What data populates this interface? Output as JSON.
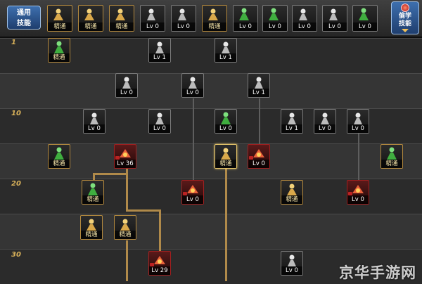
{
  "header": {
    "common_skills_label": "通用\n技能",
    "steal_skill_button": "偷学\n技能",
    "common_skills": [
      {
        "icon": "squat-figure-icon",
        "label": "精通",
        "state": "unlocked"
      },
      {
        "icon": "flail-figure-icon",
        "label": "精通",
        "state": "unlocked"
      },
      {
        "icon": "sprint-figure-icon",
        "label": "精通",
        "state": "unlocked"
      },
      {
        "icon": "eagle-wings-icon",
        "label": "Lv 0",
        "state": "locked"
      },
      {
        "icon": "target-scope-icon",
        "label": "Lv 0",
        "state": "locked"
      },
      {
        "icon": "crosshair-icon",
        "label": "精通",
        "state": "unlocked"
      },
      {
        "icon": "crouch-green-icon",
        "label": "Lv 0",
        "state": "locked"
      },
      {
        "icon": "dash-green-icon",
        "label": "Lv 0",
        "state": "locked"
      },
      {
        "icon": "eye-icon",
        "label": "Lv 0",
        "state": "locked"
      },
      {
        "icon": "strongman-icon",
        "label": "Lv 0",
        "state": "locked"
      },
      {
        "icon": "dual-blade-icon",
        "label": "Lv 0",
        "state": "locked"
      }
    ]
  },
  "level_markers": [
    "1",
    "10",
    "20",
    "30"
  ],
  "skill_tree": [
    {
      "name": "green-book-skill",
      "icon": "book-icon",
      "label": "精通",
      "state": "unlocked"
    },
    {
      "name": "rock-throw-skill",
      "icon": "rock-icon",
      "label": "Lv 1",
      "state": "locked"
    },
    {
      "name": "hammer-strike-skill",
      "icon": "hammer-icon",
      "label": "Lv 1",
      "state": "locked"
    },
    {
      "name": "flex-figure-skill",
      "icon": "flex-icon",
      "label": "Lv 0",
      "state": "locked"
    },
    {
      "name": "bow-figure-skill",
      "icon": "bow-icon",
      "label": "Lv 0",
      "state": "locked"
    },
    {
      "name": "pillar-burst-skill",
      "icon": "pillar-icon",
      "label": "Lv 1",
      "state": "locked"
    },
    {
      "name": "scatter-shot-skill",
      "icon": "scatter-icon",
      "label": "Lv 0",
      "state": "locked"
    },
    {
      "name": "spin-slash-skill",
      "icon": "slash-icon",
      "label": "Lv 0",
      "state": "locked"
    },
    {
      "name": "green-armor-skill",
      "icon": "armor-icon",
      "label": "Lv 0",
      "state": "locked"
    },
    {
      "name": "wing-dash-skill",
      "icon": "wing-icon",
      "label": "Lv 1",
      "state": "locked"
    },
    {
      "name": "whirl-strike-skill",
      "icon": "whirl-icon",
      "label": "Lv 0",
      "state": "locked"
    },
    {
      "name": "upper-kick-skill",
      "icon": "kick-icon",
      "label": "Lv 0",
      "state": "locked"
    },
    {
      "name": "aura-figure-skill",
      "icon": "aura-icon",
      "label": "精通",
      "state": "unlocked"
    },
    {
      "name": "fire-dash-skill",
      "icon": "fire-icon",
      "label": "Lv 36",
      "state": "red"
    },
    {
      "name": "ground-smash-skill",
      "icon": "smash-icon",
      "label": "精通",
      "state": "gold"
    },
    {
      "name": "blast-strike-skill",
      "icon": "blast-icon",
      "label": "Lv 0",
      "state": "red"
    },
    {
      "name": "green-star-skill",
      "icon": "star-icon",
      "label": "精通",
      "state": "unlocked"
    },
    {
      "name": "green-arrow-skill",
      "icon": "arrow-icon",
      "label": "精通",
      "state": "unlocked"
    },
    {
      "name": "flame-pillar-skill",
      "icon": "flame-pillar-icon",
      "label": "Lv 0",
      "state": "red"
    },
    {
      "name": "shield-crest-skill",
      "icon": "crest-icon",
      "label": "精通",
      "state": "unlocked"
    },
    {
      "name": "rush-kick-skill",
      "icon": "rush-icon",
      "label": "Lv 0",
      "state": "red"
    },
    {
      "name": "triple-hit-skill",
      "icon": "triple-icon",
      "label": "精通",
      "state": "unlocked"
    },
    {
      "name": "helmet-skill",
      "icon": "helmet-icon",
      "label": "精通",
      "state": "unlocked"
    },
    {
      "name": "flame-rush-skill",
      "icon": "flame-rush-icon",
      "label": "Lv 29",
      "state": "red"
    },
    {
      "name": "sword-slide-skill",
      "icon": "slide-icon",
      "label": "Lv 0",
      "state": "locked"
    }
  ],
  "watermark": "京华手游网",
  "colors": {
    "accent_gold": "#e6c56a",
    "locked_red": "#a02020",
    "button_blue": "#3d6fae"
  }
}
